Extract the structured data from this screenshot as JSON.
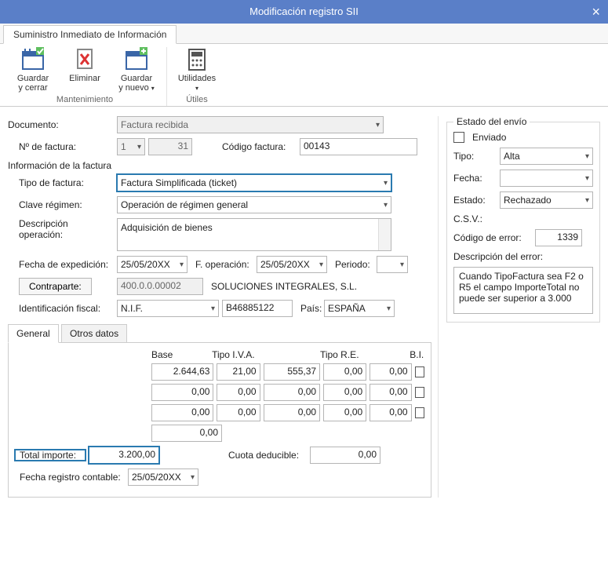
{
  "title": "Modificación registro SII",
  "tabstrip": {
    "tab": "Suministro Inmediato de Información"
  },
  "ribbon": {
    "guardar_cerrar_l1": "Guardar",
    "guardar_cerrar_l2": "y cerrar",
    "eliminar": "Eliminar",
    "guardar_nuevo_l1": "Guardar",
    "guardar_nuevo_l2": "y nuevo",
    "utilidades": "Utilidades",
    "grp_mant": "Mantenimiento",
    "grp_util": "Útiles"
  },
  "labels": {
    "documento": "Documento:",
    "nfactura": "Nº de factura:",
    "codfactura": "Código factura:",
    "info_factura": "Información de la factura",
    "tipo_factura": "Tipo de factura:",
    "clave_regimen": "Clave régimen:",
    "desc_op": "Descripción operación:",
    "fecha_exp": "Fecha de expedición:",
    "f_operacion": "F. operación:",
    "periodo": "Periodo:",
    "contraparte": "Contraparte:",
    "ident_fiscal": "Identificación fiscal:",
    "pais": "País:",
    "total_importe": "Total importe:",
    "cuota_deducible": "Cuota deducible:",
    "fecha_reg_cont": "Fecha registro contable:"
  },
  "values": {
    "documento": "Factura recibida",
    "nfactura_serie": "1",
    "nfactura_num": "31",
    "codfactura": "00143",
    "tipo_factura": "Factura Simplificada (ticket)",
    "clave_regimen": "Operación de régimen general",
    "desc_op": "Adquisición de bienes",
    "fecha_exp": "25/05/20XX",
    "f_operacion": "25/05/20XX",
    "periodo": "",
    "contraparte_codigo": "400.0.0.00002",
    "contraparte_nombre": "SOLUCIONES INTEGRALES, S.L.",
    "ident_tipo": "N.I.F.",
    "ident_num": "B46885122",
    "pais": "ESPAÑA",
    "total_importe": "3.200,00",
    "cuota_deducible": "0,00",
    "fecha_reg_cont": "25/05/20XX"
  },
  "tabs2": {
    "general": "General",
    "otros": "Otros datos"
  },
  "grid": {
    "headers": {
      "base": "Base",
      "tipo_iva": "Tipo I.V.A.",
      "tipo_re": "Tipo R.E.",
      "bi": "B.I."
    },
    "rows": [
      {
        "base": "2.644,63",
        "tipo_iva": "21,00",
        "iva": "555,37",
        "tipo_re": "0,00",
        "re": "0,00"
      },
      {
        "base": "0,00",
        "tipo_iva": "0,00",
        "iva": "0,00",
        "tipo_re": "0,00",
        "re": "0,00"
      },
      {
        "base": "0,00",
        "tipo_iva": "0,00",
        "iva": "0,00",
        "tipo_re": "0,00",
        "re": "0,00"
      }
    ],
    "extra_base": "0,00"
  },
  "envio": {
    "legend": "Estado del envío",
    "enviado": "Enviado",
    "tipo_lbl": "Tipo:",
    "tipo_val": "Alta",
    "fecha_lbl": "Fecha:",
    "fecha_val": "",
    "estado_lbl": "Estado:",
    "estado_val": "Rechazado",
    "csv_lbl": "C.S.V.:",
    "cod_err_lbl": "Código de error:",
    "cod_err_val": "1339",
    "desc_err_lbl": "Descripción del error:",
    "desc_err_val": "Cuando TipoFactura sea F2 o R5 el campo ImporteTotal no puede ser superior a 3.000"
  }
}
